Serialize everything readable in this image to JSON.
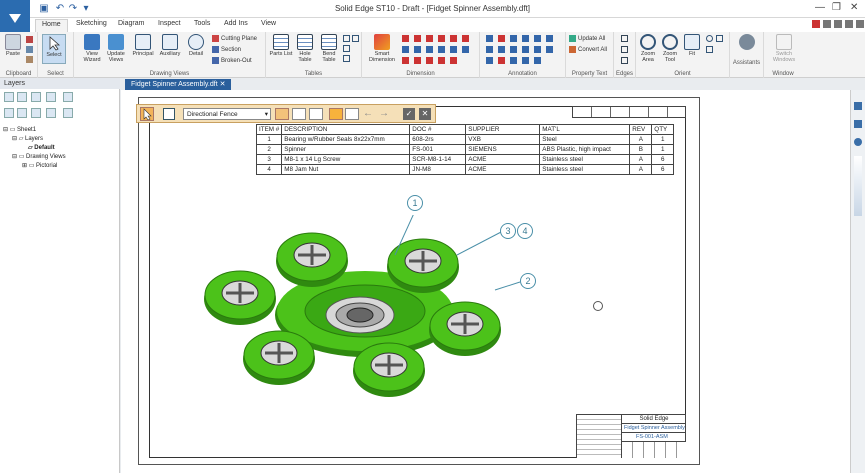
{
  "app": {
    "title": "Solid Edge ST10 - Draft - [Fidget Spinner Assembly.dft]",
    "qat_icons": [
      "save-icon",
      "undo-icon",
      "redo-icon",
      "customize-icon"
    ]
  },
  "ribbon_tabs": [
    "Home",
    "Sketching",
    "Diagram",
    "Inspect",
    "Tools",
    "Add Ins",
    "View"
  ],
  "ribbon": {
    "clipboard": {
      "label": "Clipboard",
      "paste": "Paste"
    },
    "select": {
      "label": "Select",
      "select": "Select"
    },
    "drawing_views": {
      "label": "Drawing Views",
      "buttons": [
        "View Wizard",
        "Update Views",
        "Principal",
        "Auxiliary",
        "Detail"
      ],
      "small": [
        "Cutting Plane",
        "Section",
        "Broken-Out"
      ]
    },
    "tables": {
      "label": "Tables",
      "buttons": [
        "Parts List",
        "Hole Table",
        "Bend Table"
      ]
    },
    "dimension": {
      "label": "Dimension",
      "smart": "Smart Dimension"
    },
    "annotation": {
      "label": "Annotation"
    },
    "property_text": {
      "label": "Property Text",
      "items": [
        "Update All",
        "Convert All"
      ]
    },
    "edges": {
      "label": "Edges"
    },
    "orient": {
      "label": "Orient",
      "buttons": [
        "Zoom Area",
        "Zoom Tool",
        "Fit"
      ]
    },
    "assistants": {
      "label": "Assistants"
    },
    "window": {
      "label": "Window",
      "switch": "Switch Windows"
    }
  },
  "left_panel": {
    "title": "Layers",
    "tree": [
      "Sheet1",
      "Layers",
      "Default",
      "Drawing Views",
      "Pictorial"
    ]
  },
  "document_tab": "Fidget Spinner Assembly.dft",
  "fence": {
    "mode": "Directional Fence"
  },
  "bom": {
    "headers": [
      "ITEM #",
      "DESCRIPTION",
      "DOC #",
      "SUPPLIER",
      "MAT'L",
      "REV",
      "QTY"
    ],
    "rows": [
      [
        "1",
        "Bearing w/Rubber Seals 8x22x7mm",
        "608-2rs",
        "VXB",
        "Steel",
        "A",
        "1"
      ],
      [
        "2",
        "Spinner",
        "FS-001",
        "SIEMENS",
        "ABS Plastic, high impact",
        "B",
        "1"
      ],
      [
        "3",
        "M8-1 x 14 Lg Screw",
        "SCR-M8-1-14",
        "ACME",
        "Stainless steel",
        "A",
        "6"
      ],
      [
        "4",
        "M8 Jam Nut",
        "JN-M8",
        "ACME",
        "Stainless steel",
        "A",
        "6"
      ]
    ]
  },
  "balloons": [
    "1",
    "3",
    "4",
    "2"
  ],
  "title_block": {
    "company": "Solid Edge",
    "title": "Fidget Spinner Assembly",
    "doc": "FS-001-ASM"
  },
  "colors": {
    "accent": "#2b6cb0",
    "part_green": "#4cc21a",
    "doc_tab": "#2a5f9c"
  }
}
